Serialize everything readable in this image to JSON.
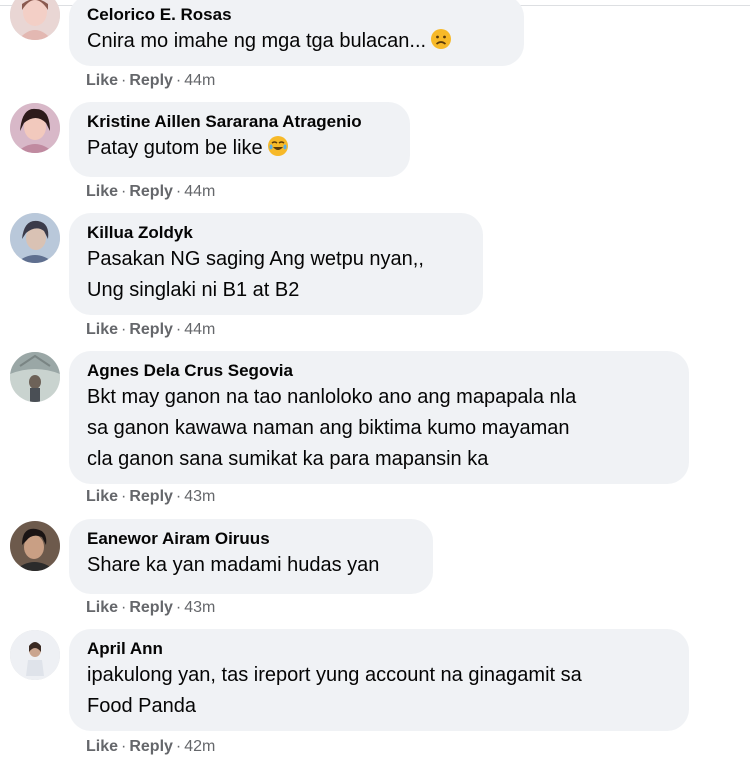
{
  "comments": [
    {
      "author": "Celorico E. Rosas",
      "lines": [
        "Cnira mo imahe ng mga tga bulacan..."
      ],
      "emoji": "sad-face-emoji",
      "like": "Like",
      "reply": "Reply",
      "time": "44m",
      "avatar": "avatar-photo"
    },
    {
      "author": "Kristine Aillen Sararana Atragenio",
      "lines": [
        "Patay gutom be like"
      ],
      "emoji": "laughing-crying-emoji",
      "like": "Like",
      "reply": "Reply",
      "time": "44m",
      "avatar": "avatar-photo"
    },
    {
      "author": "Killua Zoldyk",
      "lines": [
        "Pasakan NG saging Ang wetpu nyan,,",
        "Ung singlaki ni B1 at B2"
      ],
      "like": "Like",
      "reply": "Reply",
      "time": "44m",
      "avatar": "avatar-photo"
    },
    {
      "author": "Agnes Dela Crus Segovia",
      "lines": [
        "Bkt may ganon na tao nanloloko ano ang mapapala nla",
        "sa ganon kawawa naman ang biktima kumo mayaman",
        "cla ganon sana sumikat ka para mapansin ka"
      ],
      "like": "Like",
      "reply": "Reply",
      "time": "43m",
      "avatar": "avatar-photo"
    },
    {
      "author": "Eanewor Airam Oiruus",
      "lines": [
        "Share ka yan madami hudas yan"
      ],
      "like": "Like",
      "reply": "Reply",
      "time": "43m",
      "avatar": "avatar-photo"
    },
    {
      "author": "April Ann",
      "lines": [
        "ipakulong yan, tas ireport yung account na ginagamit sa",
        "Food Panda"
      ],
      "like": "Like",
      "reply": "Reply",
      "time": "42m",
      "avatar": "avatar-photo"
    }
  ],
  "colors": {
    "bubble": "#f0f2f5",
    "meta_text": "#65676b",
    "body_text": "#050505"
  }
}
